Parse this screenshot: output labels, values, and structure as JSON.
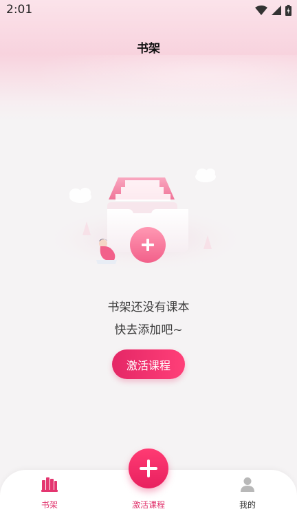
{
  "status_bar": {
    "time": "2:01",
    "icons": [
      "wifi-icon",
      "signal-icon",
      "battery-icon"
    ]
  },
  "header": {
    "title": "书架"
  },
  "empty_state": {
    "line1": "书架还没有课本",
    "line2": "快去添加吧~",
    "button_label": "激活课程"
  },
  "tabbar": {
    "items": [
      {
        "label": "书架",
        "icon": "bookshelf-icon",
        "active": true
      },
      {
        "label": "激活课程",
        "icon": "plus-icon",
        "active": false
      },
      {
        "label": "我的",
        "icon": "person-icon",
        "active": false
      }
    ]
  },
  "colors": {
    "accent": "#e42766",
    "accent_light": "#ff3f78",
    "background": "#f5f3f4",
    "header_pink": "#f8d3de"
  }
}
